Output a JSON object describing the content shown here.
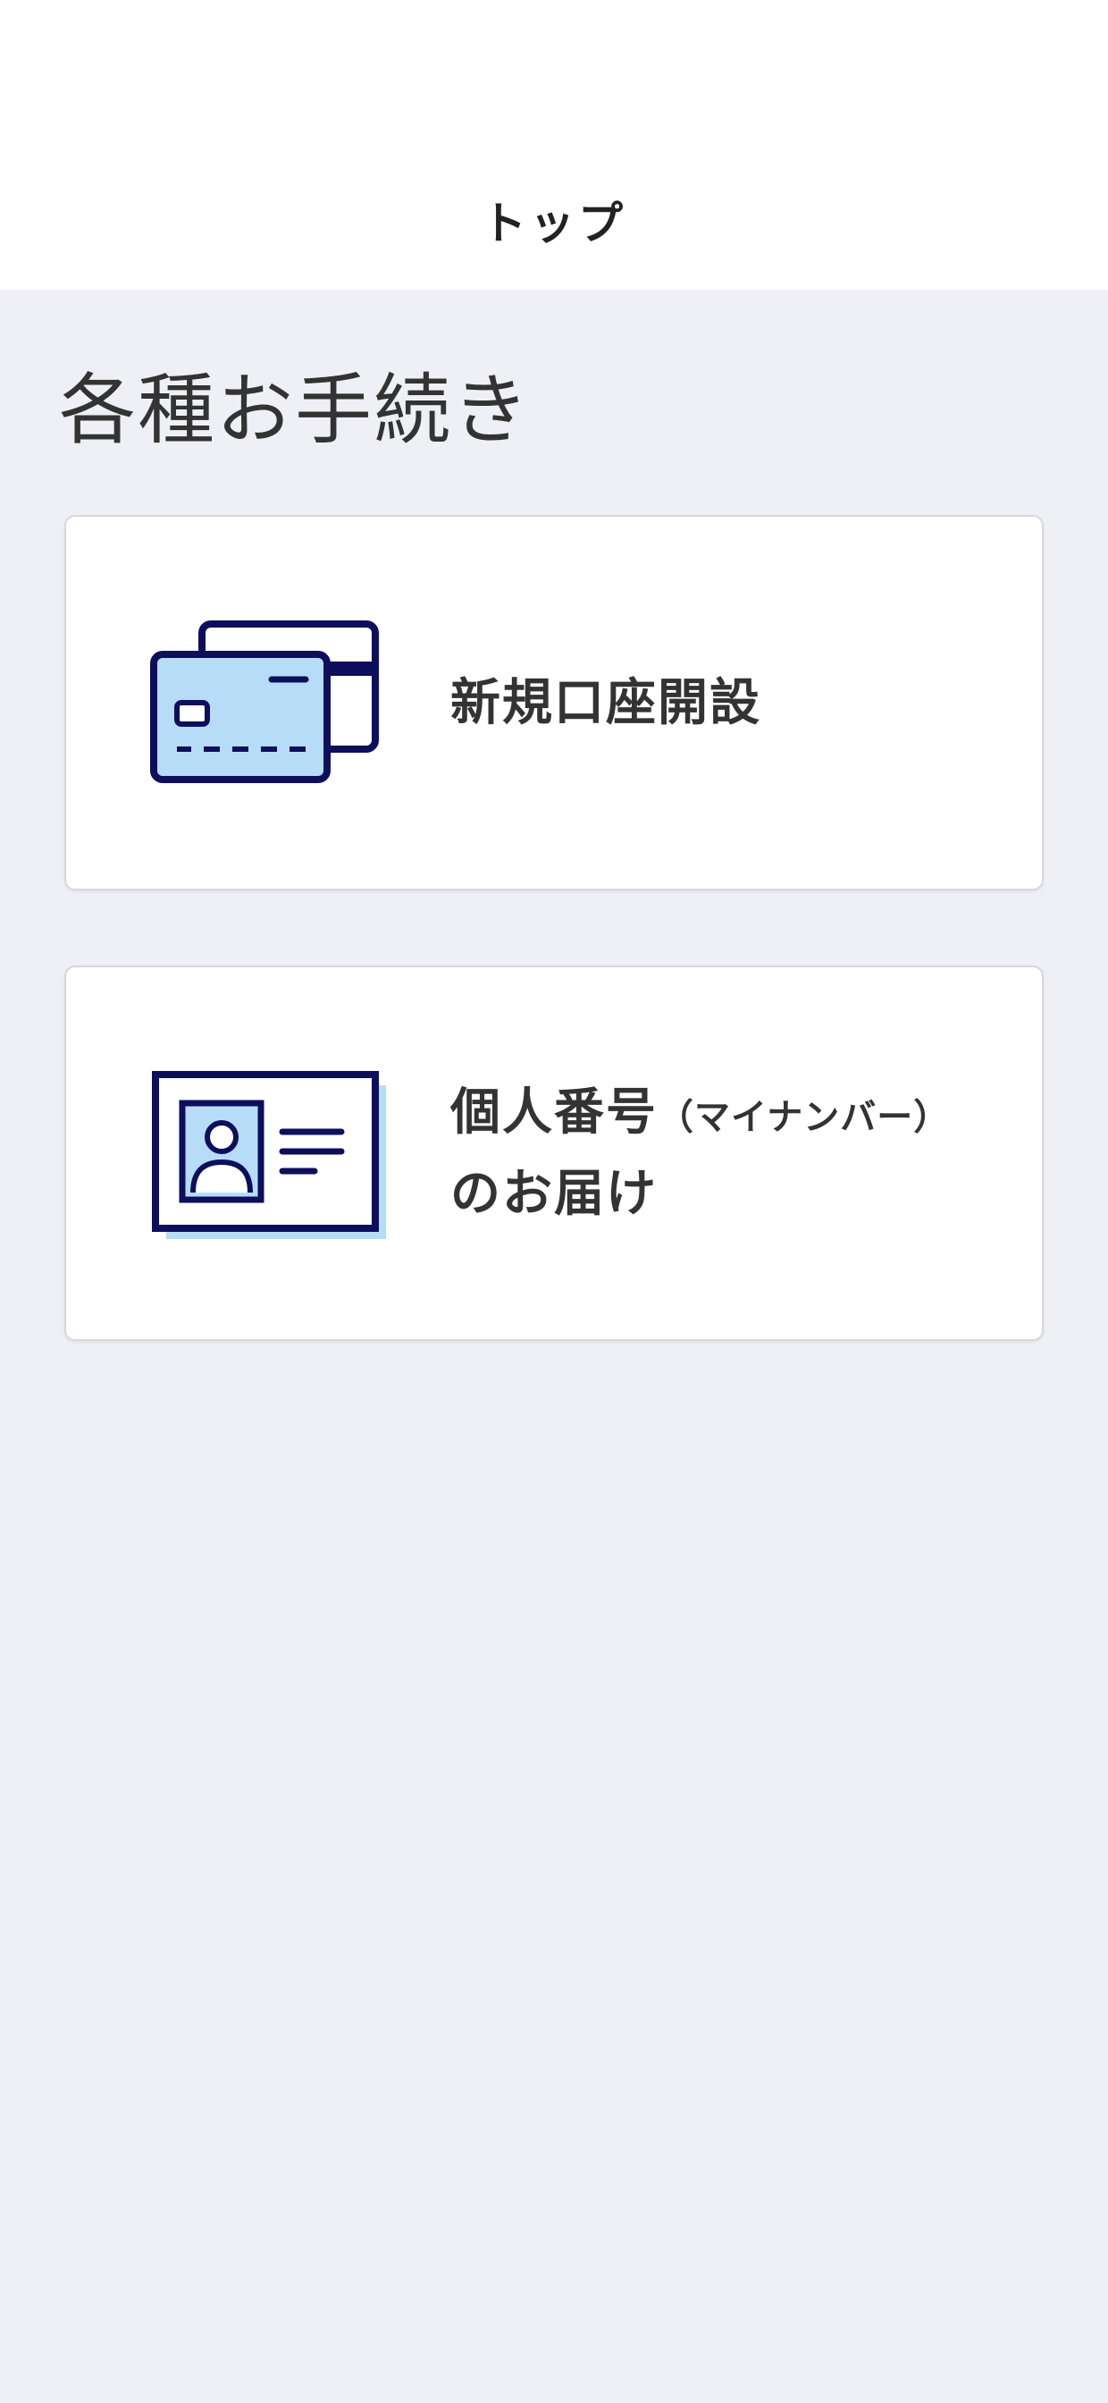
{
  "header": {
    "title": "トップ"
  },
  "page": {
    "title": "各種お手続き"
  },
  "menu": [
    {
      "label": "新規口座開設",
      "icon": "credit-card-icon"
    },
    {
      "label_main": "個人番号",
      "label_sub": "（マイナンバー）",
      "label_line2": "のお届け",
      "icon": "id-card-icon"
    }
  ],
  "colors": {
    "background": "#eff0f5",
    "card": "#ffffff",
    "icon_navy": "#0d0f5c",
    "icon_light_blue": "#b7dcf8",
    "text": "#333333"
  }
}
